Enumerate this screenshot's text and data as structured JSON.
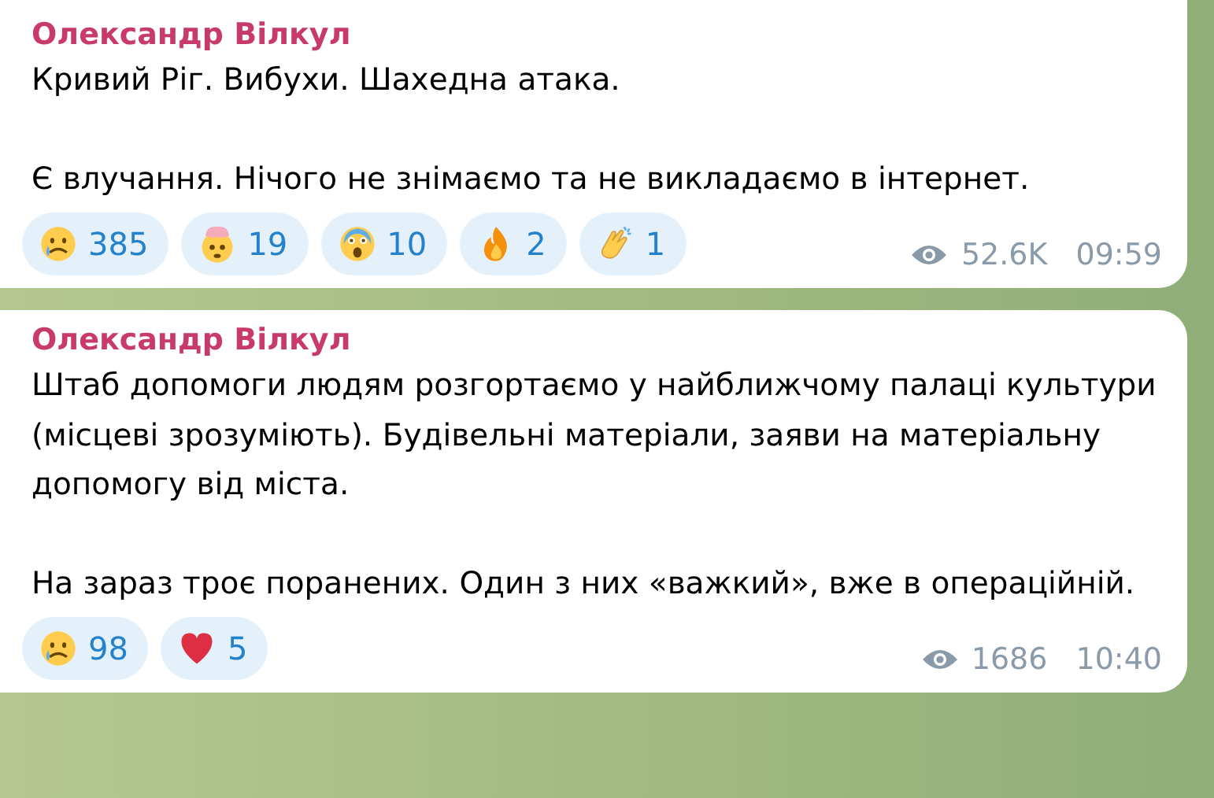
{
  "messages": [
    {
      "author": "Олександр Вілкул",
      "paragraphs": [
        "Кривий Ріг. Вибухи. Шахедна атака.",
        "Є влучання. Нічого не знімаємо та не викладаємо в інтернет."
      ],
      "reactions": [
        {
          "kind": "crying",
          "count": "385"
        },
        {
          "kind": "exploding",
          "count": "19"
        },
        {
          "kind": "scream",
          "count": "10"
        },
        {
          "kind": "fire",
          "count": "2"
        },
        {
          "kind": "clap",
          "count": "1"
        }
      ],
      "views": "52.6K",
      "time": "09:59"
    },
    {
      "author": "Олександр Вілкул",
      "paragraphs": [
        "Штаб допомоги людям розгортаємо у найближчому палаці культури (місцеві зрозуміють). Будівельні матеріали, заяви на матеріальну допомогу від міста.",
        "На зараз троє поранених. Один з них «важкий», вже в операційній."
      ],
      "reactions": [
        {
          "kind": "crying",
          "count": "98"
        },
        {
          "kind": "heart",
          "count": "5"
        }
      ],
      "views": "1686",
      "time": "10:40"
    }
  ]
}
